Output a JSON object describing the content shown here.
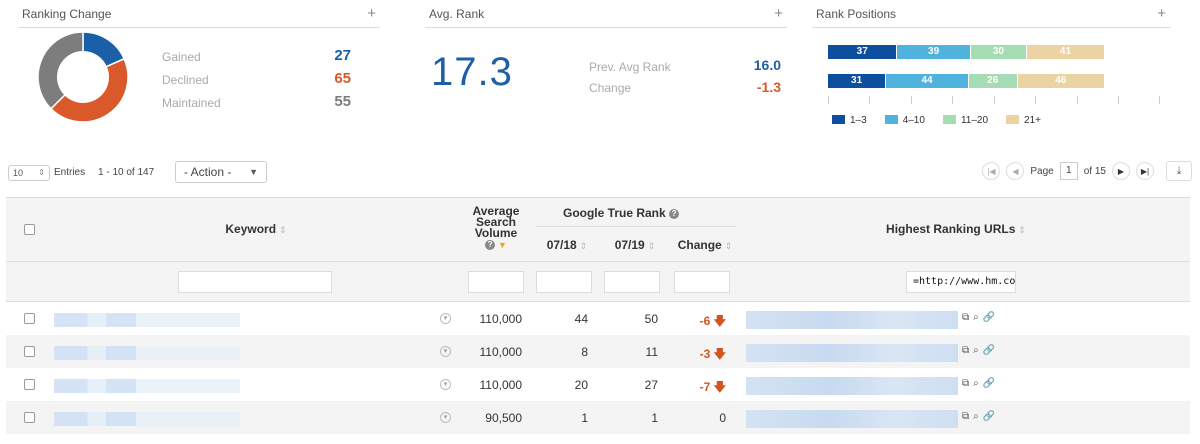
{
  "ranking_change": {
    "title": "Ranking Change",
    "items": [
      {
        "label": "Gained",
        "value": "27",
        "color": "#1a5fa8"
      },
      {
        "label": "Declined",
        "value": "65",
        "color": "#d9592b"
      },
      {
        "label": "Maintained",
        "value": "55",
        "color": "#7d7d7d"
      }
    ]
  },
  "avg_rank": {
    "title": "Avg. Rank",
    "value": "17.3",
    "prev_label": "Prev. Avg Rank",
    "prev_value": "16.0",
    "change_label": "Change",
    "change_value": "-1.3"
  },
  "rank_positions": {
    "title": "Rank Positions",
    "bars": [
      {
        "segments": [
          "37",
          "39",
          "30",
          "41"
        ]
      },
      {
        "segments": [
          "31",
          "44",
          "26",
          "46"
        ]
      }
    ],
    "legend": [
      "1–3",
      "4–10",
      "11–20",
      "21+"
    ],
    "colors": [
      "#0d4f9e",
      "#4fb3dd",
      "#a6dcb3",
      "#ecd3a3"
    ]
  },
  "toolbar": {
    "entries_value": "10",
    "entries_label": "Entries",
    "range": "1 - 10 of 147",
    "action": "- Action -",
    "page_label": "Page",
    "page_value": "1",
    "of_pages": "of 15"
  },
  "table": {
    "col_keyword": "Keyword",
    "col_volume": "Average Search Volume",
    "col_google": "Google True Rank",
    "col_0718": "07/18",
    "col_0719": "07/19",
    "col_change": "Change",
    "col_urls": "Highest Ranking URLs",
    "url_filter": "=http://www.hm.co",
    "rows": [
      {
        "volume": "110,000",
        "r1": "44",
        "r2": "50",
        "change": "-6",
        "dir": "down"
      },
      {
        "volume": "110,000",
        "r1": "8",
        "r2": "11",
        "change": "-3",
        "dir": "down"
      },
      {
        "volume": "110,000",
        "r1": "20",
        "r2": "27",
        "change": "-7",
        "dir": "down"
      },
      {
        "volume": "90,500",
        "r1": "1",
        "r2": "1",
        "change": "0",
        "dir": "none"
      }
    ]
  }
}
